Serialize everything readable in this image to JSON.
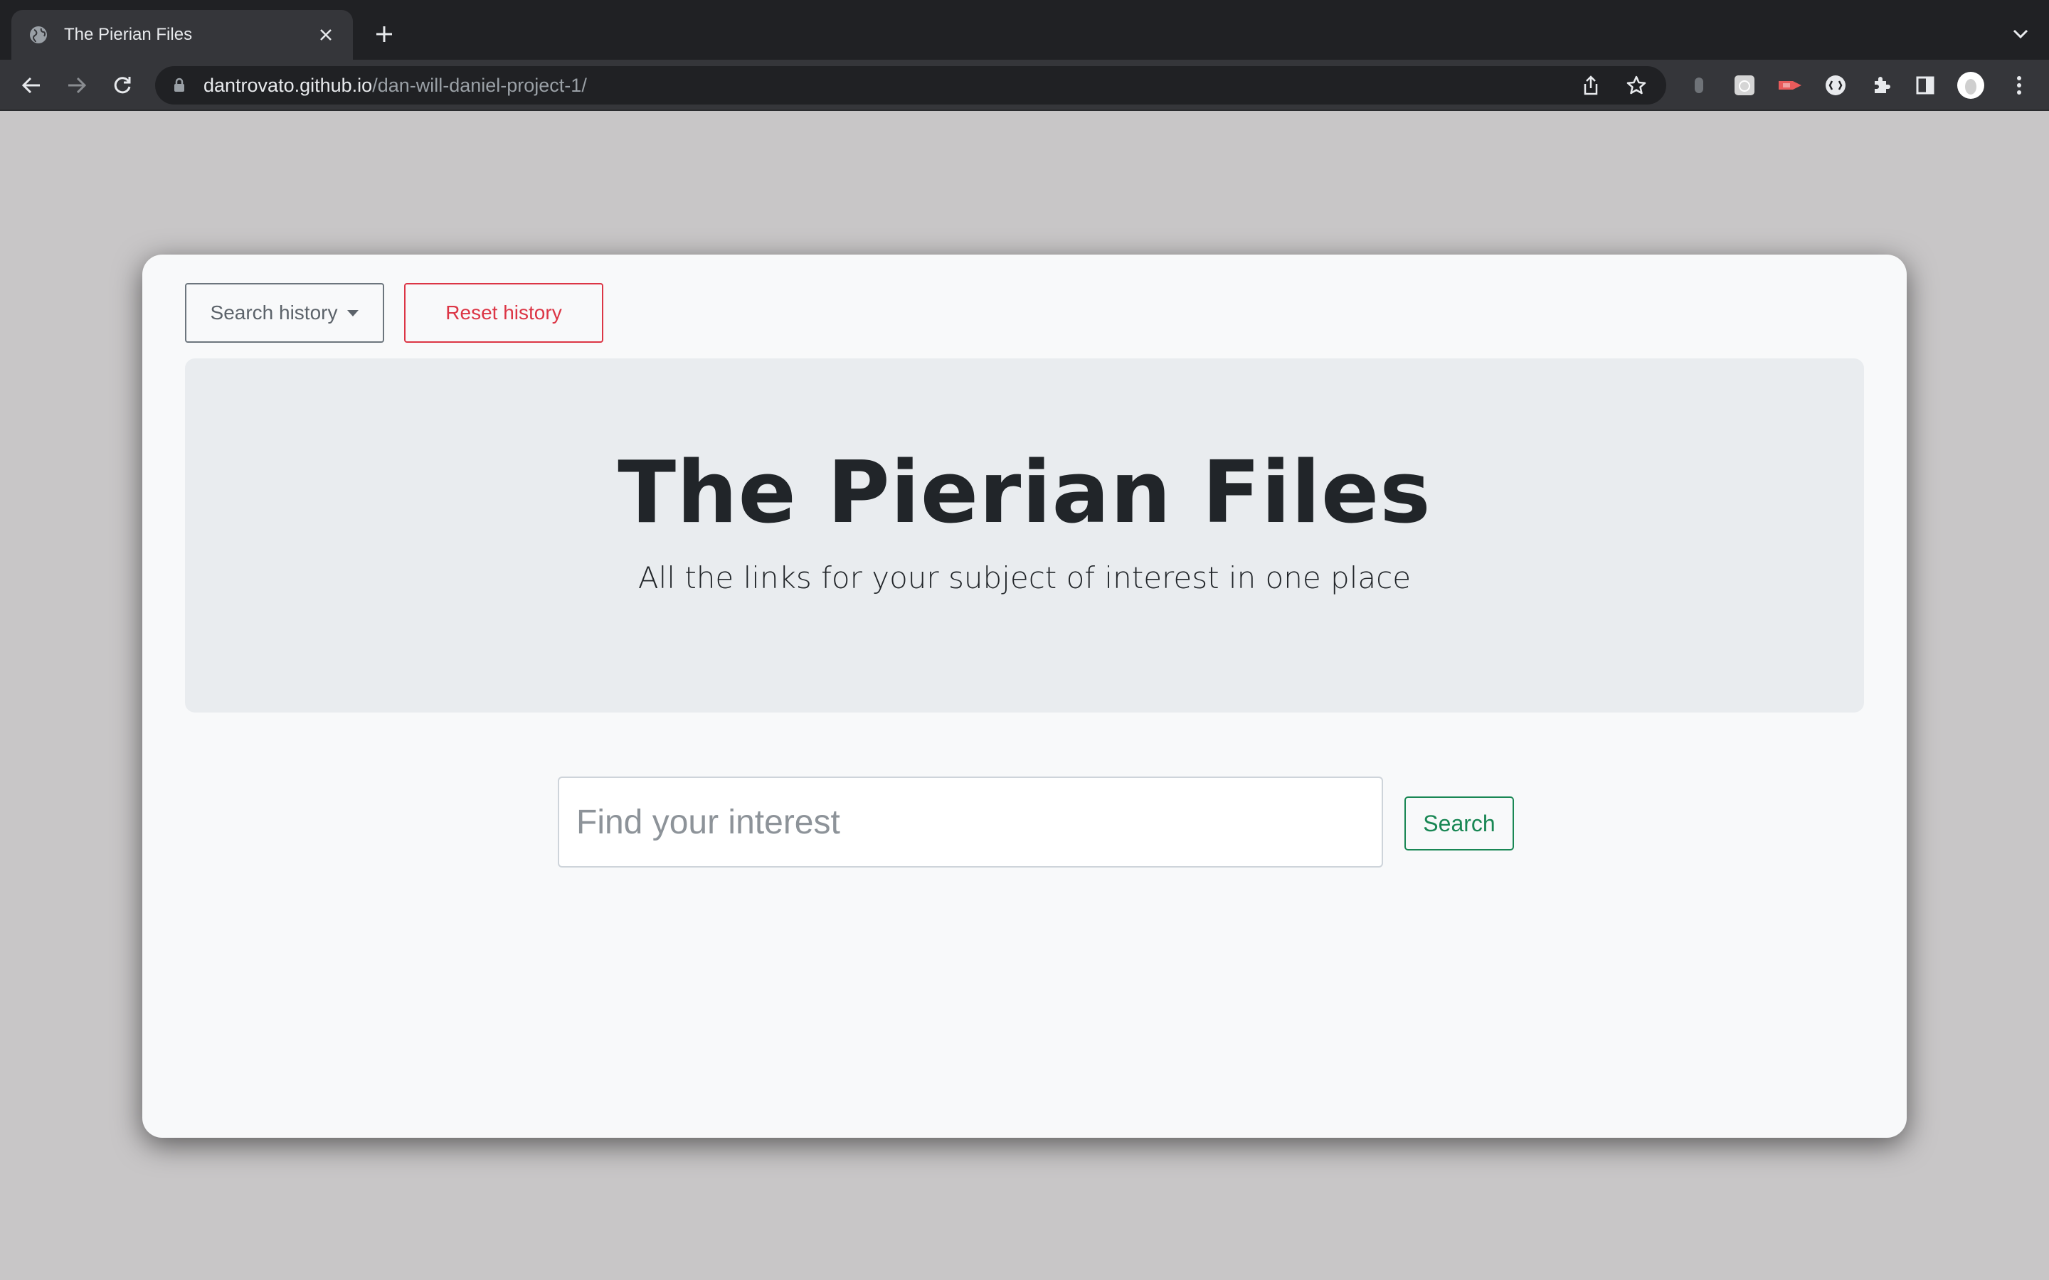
{
  "browser": {
    "tab": {
      "title": "The Pierian Files"
    },
    "address_bar": {
      "host": "dantrovato.github.io",
      "path": "/dan-will-daniel-project-1/"
    }
  },
  "page": {
    "history_button_label": "Search history",
    "reset_button_label": "Reset history",
    "hero": {
      "title": "The Pierian Files",
      "subtitle": "All the links for your subject of interest in one place"
    },
    "search": {
      "placeholder": "Find your interest",
      "button_label": "Search"
    }
  },
  "colors": {
    "reset_red": "#dc3545",
    "search_green": "#198754",
    "secondary_gray": "#6c757d"
  },
  "icons": [
    "globe-icon",
    "close-icon",
    "plus-icon",
    "chevron-down-icon",
    "back-arrow-icon",
    "forward-arrow-icon",
    "reload-icon",
    "lock-icon",
    "share-icon",
    "star-icon",
    "puzzle-icon",
    "sidepanel-icon",
    "avatar",
    "kebab-menu-icon"
  ]
}
